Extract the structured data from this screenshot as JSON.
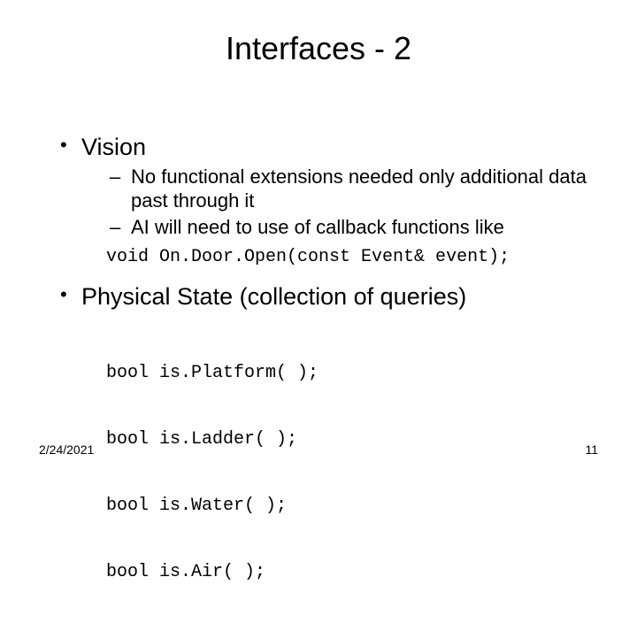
{
  "slide": {
    "title": "Interfaces - 2",
    "bullets": [
      {
        "text": "Vision",
        "sub": [
          "No functional extensions needed only additional data past through it",
          "AI will need to use of callback functions like"
        ],
        "code": "void On.Door.Open(const Event& event);"
      },
      {
        "text": "Physical State (collection of queries)",
        "code_lines": [
          "bool is.Platform( );",
          "bool is.Ladder( );",
          "bool is.Water( );",
          "bool is.Air( );"
        ]
      }
    ],
    "footer": {
      "date": "2/24/2021",
      "page": "11"
    }
  }
}
